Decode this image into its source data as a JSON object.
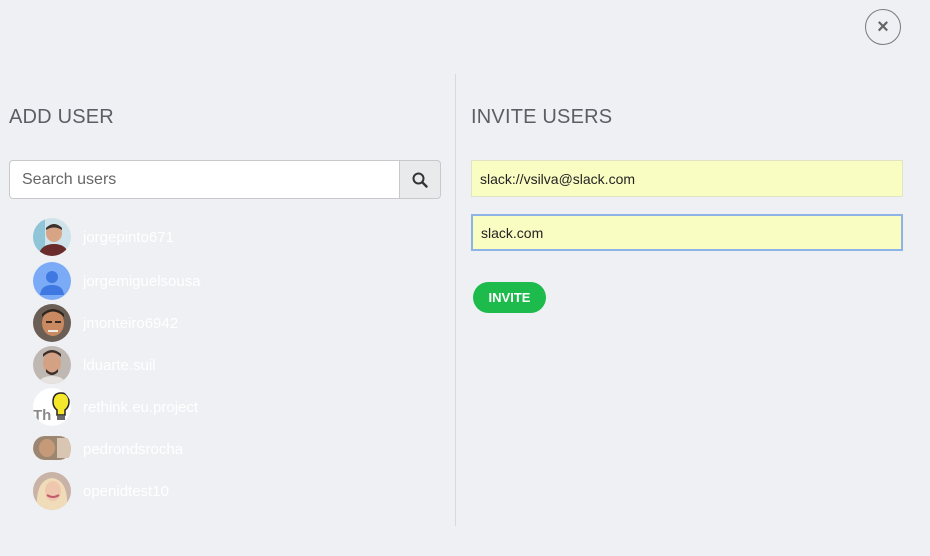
{
  "close": {
    "icon": "close-icon",
    "symbol": "×"
  },
  "add_user": {
    "title": "ADD USER",
    "search": {
      "placeholder": "Search users",
      "value": "",
      "icon": "search-icon"
    },
    "users": [
      {
        "name": "jorgepinto671",
        "avatar": "photo"
      },
      {
        "name": "jorgemiguelsousa",
        "avatar": "default-person"
      },
      {
        "name": "jmonteiro6942",
        "avatar": "photo"
      },
      {
        "name": "lduarte.suil",
        "avatar": "photo"
      },
      {
        "name": "rethink.eu.project",
        "avatar": "lightbulb-logo"
      },
      {
        "name": "pedrondsrocha",
        "avatar": "photo"
      },
      {
        "name": "openidtest10",
        "avatar": "photo"
      }
    ]
  },
  "invite_users": {
    "title": "INVITE USERS",
    "fields": [
      {
        "value": "slack://vsilva@slack.com"
      },
      {
        "value": "slack.com"
      }
    ],
    "button_label": "INVITE"
  },
  "colors": {
    "background": "#eef0f4",
    "invite_button": "#1dba4c",
    "input_fill": "#fafdc2",
    "focus_border": "#8eb4e6"
  }
}
